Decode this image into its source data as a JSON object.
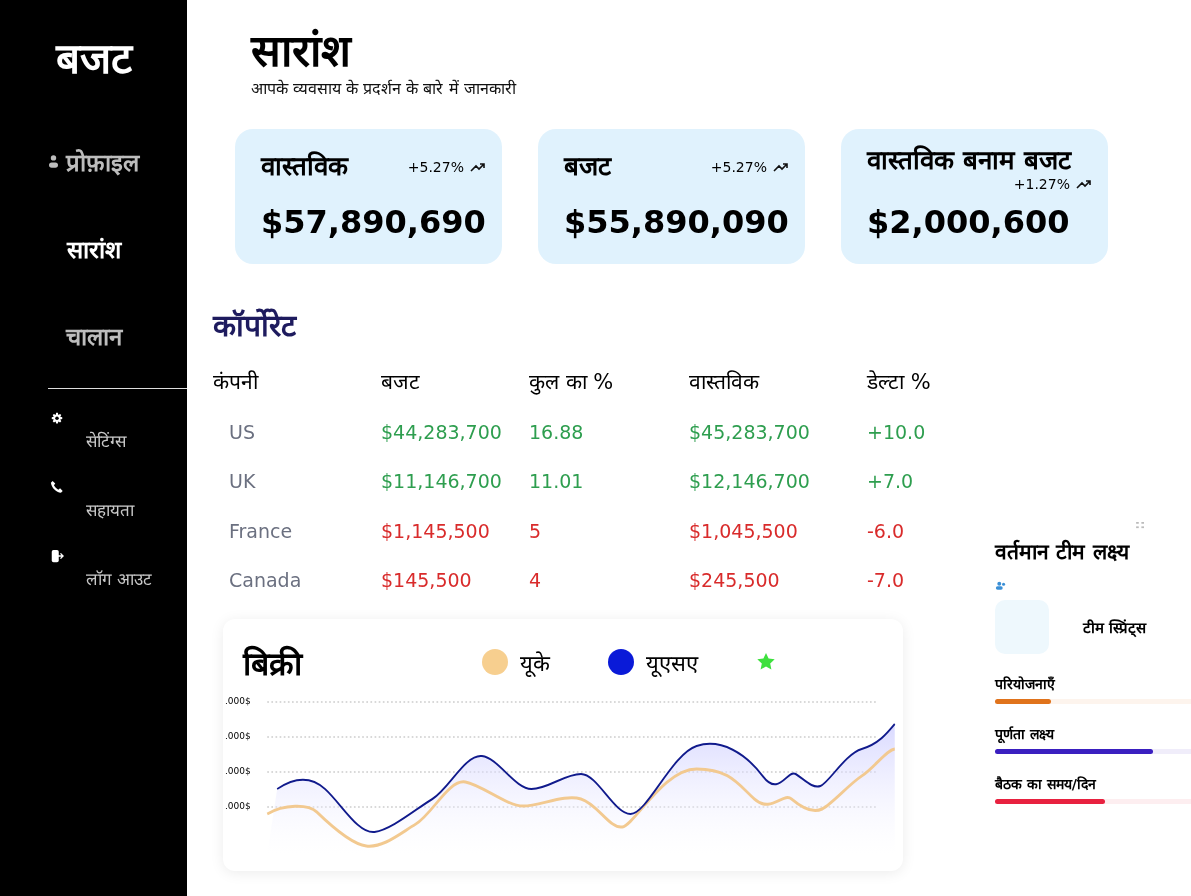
{
  "sidebar": {
    "brand": "बजट",
    "nav": [
      {
        "label": "प्रोफ़ाइल",
        "selected": false
      },
      {
        "label": "सारांश",
        "selected": true
      },
      {
        "label": "चालान",
        "selected": false
      }
    ],
    "secondary": [
      "सेटिंग्स",
      "सहायता",
      "लॉग आउट"
    ]
  },
  "header": {
    "title": "सारांश",
    "subtitle": "आपके व्यवसाय के प्रदर्शन के बारे में जानकारी"
  },
  "cards": [
    {
      "title": "वास्तविक",
      "change": "+5.27%",
      "value": "$57,890,690"
    },
    {
      "title": "बजट",
      "change": "+5.27%",
      "value": "$55,890,090"
    },
    {
      "title": "वास्तविक बनाम बजट",
      "change": "+1.27%",
      "value": "$2,000,600"
    }
  ],
  "corporate": {
    "title": "कॉर्पोरेट",
    "columns": [
      "कंपनी",
      "बजट",
      "कुल का %",
      "वास्तविक",
      "डेल्टा %"
    ],
    "rows": [
      {
        "kind": "gain",
        "cells": [
          "US",
          "$44,283,700",
          "16.88",
          "$45,283,700",
          "+10.0"
        ]
      },
      {
        "kind": "gain",
        "cells": [
          "UK",
          "$11,146,700",
          "11.01",
          "$12,146,700",
          "+7.0"
        ]
      },
      {
        "kind": "loss",
        "cells": [
          "France",
          "$1,145,500",
          "5",
          "$1,045,500",
          "-6.0"
        ]
      },
      {
        "kind": "loss",
        "cells": [
          "Canada",
          "$145,500",
          "4",
          "$245,500",
          "-7.0"
        ]
      }
    ]
  },
  "sales_chart": {
    "title": "बिक्री",
    "legend": [
      {
        "label": "यूके",
        "color": "#f7cf8f"
      },
      {
        "label": "यूएसए",
        "color": "#0a1ad8"
      }
    ],
    "y_labels": [
      ".000$",
      ".000$",
      ".000$",
      ".000$"
    ]
  },
  "team_goals": {
    "title": "वर्तमान टीम लक्ष्य",
    "tile_label": "टीम स्प्रिंट्स",
    "goals": [
      {
        "label": "परियोजनाएँ",
        "level": 0.28,
        "color": "#e0731c"
      },
      {
        "label": "पूर्णता लक्ष्य",
        "level": 0.79,
        "color": "#3a1fc0"
      },
      {
        "label": "बैठक का समय/दिन",
        "level": 0.55,
        "color": "#e8213f"
      }
    ]
  }
}
